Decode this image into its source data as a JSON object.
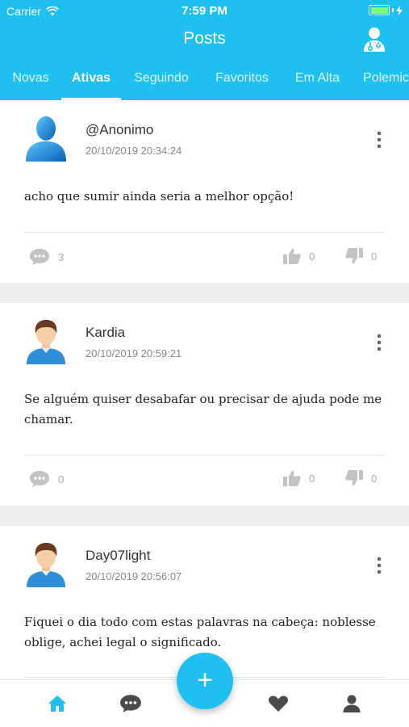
{
  "status_bar": {
    "carrier": "Carrier",
    "time": "7:59 PM"
  },
  "header": {
    "title": "Posts",
    "profile_icon": "user-doctor-icon"
  },
  "tabs": [
    {
      "label": "Novas"
    },
    {
      "label": "Ativas",
      "active": true
    },
    {
      "label": "Seguindo"
    },
    {
      "label": "Favoritos"
    },
    {
      "label": "Em Alta"
    },
    {
      "label": "Polemicos"
    }
  ],
  "posts": [
    {
      "author": "@Anonimo",
      "datetime": "20/10/2019 20:34:24",
      "text": "acho que sumir ainda seria a melhor opção!",
      "comments": "3",
      "likes": "0",
      "dislikes": "0",
      "avatar": "anonymous-avatar"
    },
    {
      "author": "Kardia",
      "datetime": "20/10/2019 20:59:21",
      "text": "Se alguém quiser desabafar ou precisar de ajuda pode me chamar.",
      "comments": "0",
      "likes": "0",
      "dislikes": "0",
      "avatar": "user-avatar"
    },
    {
      "author": "Day07light",
      "datetime": "20/10/2019 20:56:07",
      "text": "Fiquei o dia todo com estas palavras na cabeça: noblesse oblige, achei legal o significado.",
      "comments": "",
      "likes": "",
      "dislikes": "",
      "avatar": "user-avatar"
    }
  ],
  "bottom_nav": {
    "items": [
      "home-icon",
      "chat-icon",
      "heart-icon",
      "profile-icon"
    ],
    "active": "home-icon",
    "fab_label": "+"
  },
  "colors": {
    "primary": "#1ec0f2",
    "active_nav": "#1ec0f2",
    "inactive_nav": "#4a4a4a"
  }
}
